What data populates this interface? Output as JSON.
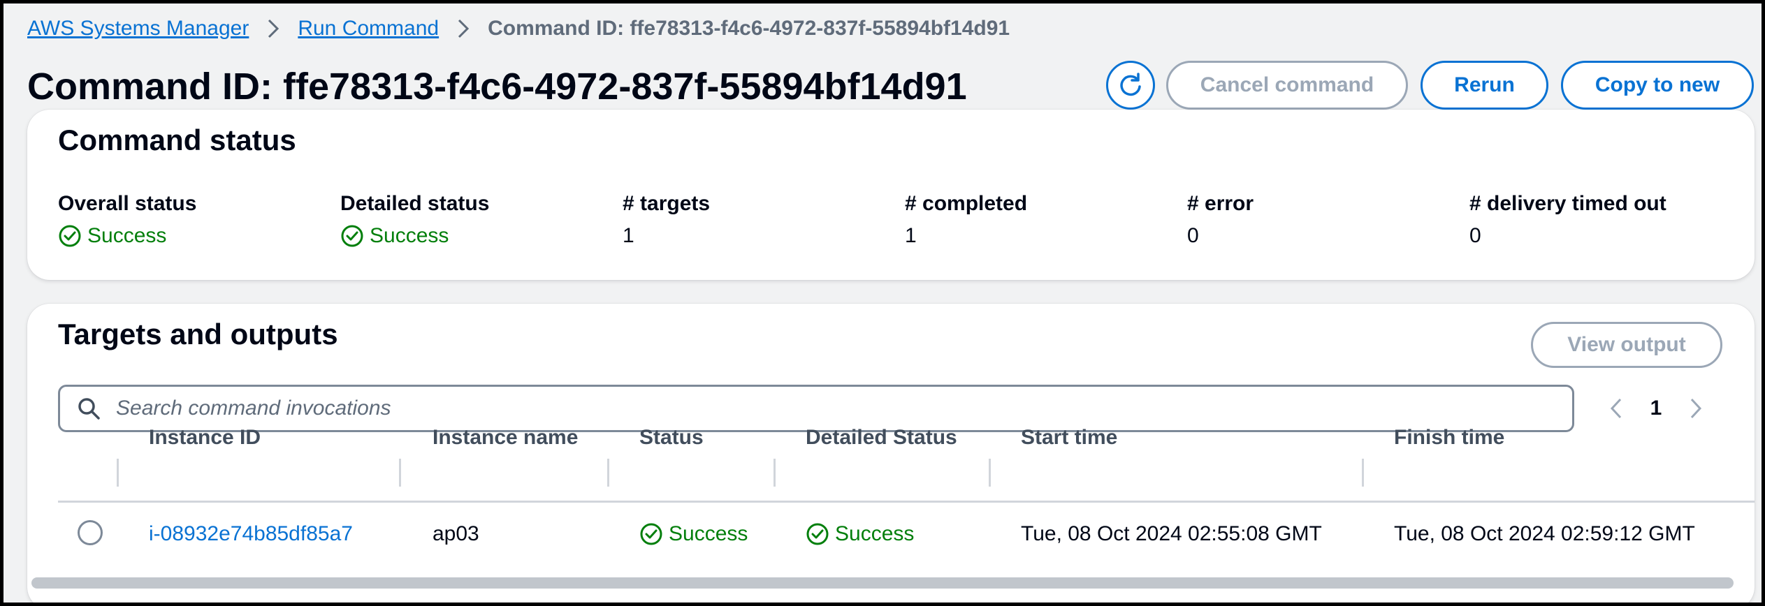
{
  "breadcrumb": {
    "items": [
      "AWS Systems Manager",
      "Run Command"
    ],
    "current": "Command ID: ffe78313-f4c6-4972-837f-55894bf14d91"
  },
  "header": {
    "title": "Command ID: ffe78313-f4c6-4972-837f-55894bf14d91",
    "buttons": {
      "refresh_icon": "refresh-icon",
      "cancel": "Cancel command",
      "rerun": "Rerun",
      "copy": "Copy to new"
    }
  },
  "status": {
    "title": "Command status",
    "columns": [
      {
        "label": "Overall status",
        "value": "Success"
      },
      {
        "label": "Detailed status",
        "value": "Success"
      },
      {
        "label": "# targets",
        "value": "1"
      },
      {
        "label": "# completed",
        "value": "1"
      },
      {
        "label": "# error",
        "value": "0"
      },
      {
        "label": "# delivery timed out",
        "value": "0"
      }
    ]
  },
  "targets": {
    "title": "Targets and outputs",
    "view_output": "View output",
    "search_placeholder": "Search command invocations",
    "page": "1",
    "columns": [
      "Instance ID",
      "Instance name",
      "Status",
      "Detailed Status",
      "Start time",
      "Finish time"
    ],
    "rows": [
      {
        "instance_id": "i-08932e74b85df85a7",
        "instance_name": "ap03",
        "status": "Success",
        "detailed_status": "Success",
        "start_time": "Tue, 08 Oct 2024 02:55:08 GMT",
        "finish_time": "Tue, 08 Oct 2024 02:59:12 GMT"
      }
    ]
  },
  "colors": {
    "link": "#0972d3",
    "success": "#037f0c",
    "disabled": "#9ba7b6",
    "text": "#000716"
  }
}
